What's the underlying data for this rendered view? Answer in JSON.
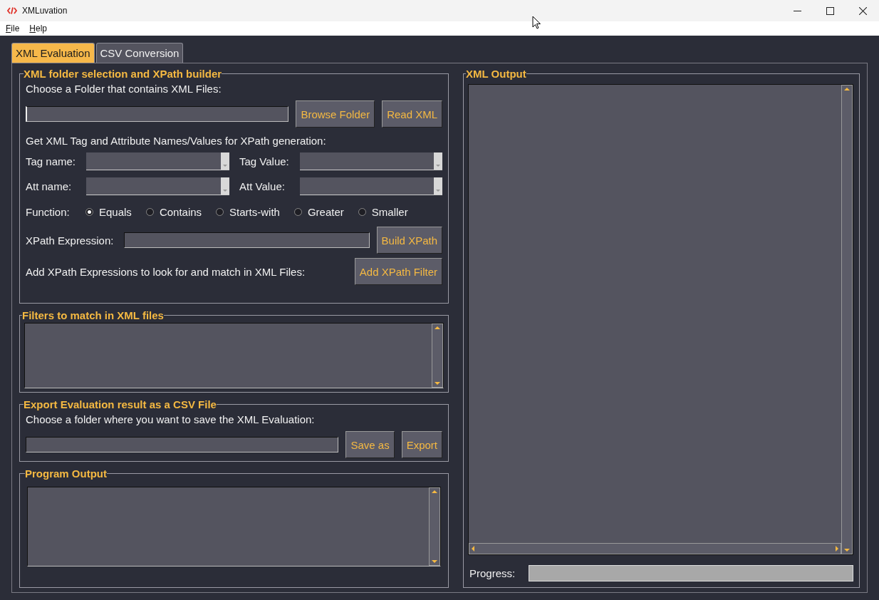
{
  "window": {
    "title": "XMLuvation"
  },
  "menu": [
    {
      "label": "File"
    },
    {
      "label": "Help"
    }
  ],
  "tabs": [
    {
      "label": "XML Evaluation",
      "selected": true
    },
    {
      "label": "CSV Conversion",
      "selected": false
    }
  ],
  "xpath_builder": {
    "title": "XML folder selection and XPath builder",
    "folder_prompt": "Choose a Folder that contains XML Files:",
    "folder_buttons": [
      "Browse Folder",
      "Read XML"
    ],
    "generation_hint": "Get XML Tag and Attribute Names/Values for XPath generation:",
    "combos": [
      {
        "label": "Tag name:"
      },
      {
        "label": "Tag Value:"
      },
      {
        "label": "Att name:"
      },
      {
        "label": "Att Value:"
      }
    ],
    "function_label": "Function:",
    "functions": [
      {
        "label": "Equals",
        "selected": true
      },
      {
        "label": "Contains",
        "selected": false
      },
      {
        "label": "Starts-with",
        "selected": false
      },
      {
        "label": "Greater",
        "selected": false
      },
      {
        "label": "Smaller",
        "selected": false
      }
    ],
    "expression_label": "XPath Expression:",
    "build_button": "Build XPath",
    "filter_hint": "Add XPath Expressions to look for and match in XML Files:",
    "add_filter_button": "Add XPath Filter"
  },
  "filters": {
    "title": "Filters to match in XML files"
  },
  "export": {
    "title": "Export Evaluation result as a CSV File",
    "prompt": "Choose a folder where you want to save the XML Evaluation:",
    "buttons": [
      "Save as",
      "Export"
    ]
  },
  "program_output": {
    "title": "Program Output"
  },
  "xml_output": {
    "title": "XML Output",
    "progress_label": "Progress:",
    "progress": {
      "level": 0
    }
  }
}
